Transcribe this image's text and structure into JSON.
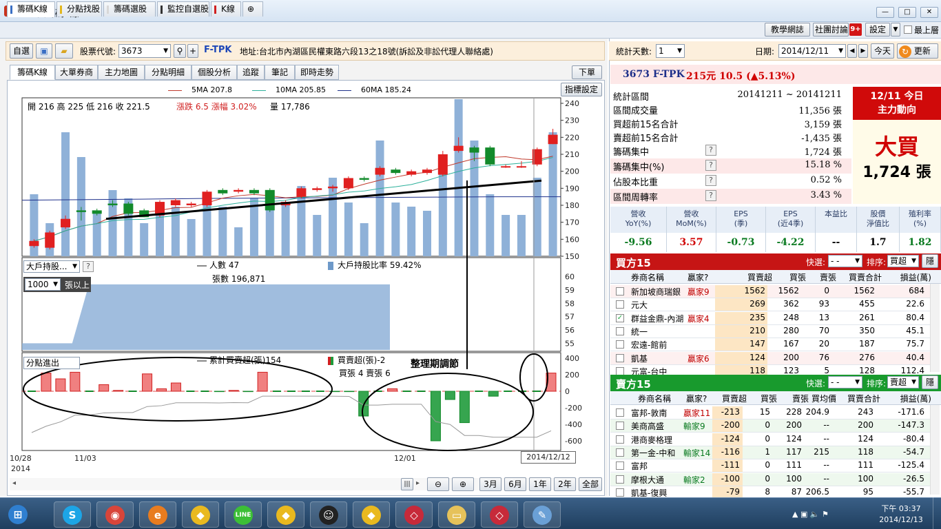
{
  "window": {
    "title": "理財寶籌碼K線"
  },
  "main_tabs": [
    {
      "label": "籌碼K線",
      "color": "#3a6fc4"
    },
    {
      "label": "分點找股",
      "color": "#e2b71d"
    },
    {
      "label": "籌碼選股",
      "color": "#e2e2e2"
    },
    {
      "label": "監控自選股",
      "color": "#333333"
    },
    {
      "label": "K線",
      "color": "#d02020"
    }
  ],
  "top_right": {
    "teach": "教學網誌",
    "forum": "社團討論",
    "forum_badge": "9+",
    "settings": "設定",
    "pin": "最上層"
  },
  "toolbar": {
    "watchlist_label": "自選",
    "code_label": "股票代號:",
    "code_value": "3673",
    "code_suffix": "F-TPK",
    "address": "地址:台北市內湖區民權東路六段13之18號(訴訟及非訟代理人聯絡處)"
  },
  "sub_tabs": [
    "籌碼K線",
    "大單券商",
    "主力地圖",
    "分點明細",
    "個股分析",
    "追蹤",
    "筆記",
    "即時走勢"
  ],
  "sub_tabs_right": {
    "order": "下單",
    "indicator_settings": "指標設定"
  },
  "chart": {
    "ma_legend": [
      {
        "label": "5MA 207.8",
        "color": "#c0392b"
      },
      {
        "label": "10MA 205.85",
        "color": "#2bb09a"
      },
      {
        "label": "60MA 185.24",
        "color": "#1d2f8a"
      }
    ],
    "ohlc_text": "開 216  高 225  低 216  收 221.5",
    "change_text": "漲跌 6.5  漲幅  3.02%",
    "volume_text": "量 17,786",
    "holder_select": "大戶持股...",
    "holder_min": "1000",
    "holder_unit": "張以上",
    "holder_people": "人數 47",
    "holder_shares": "張數 196,871",
    "holder_ratio": "大戶持股比率 59.42%",
    "branch_label": "分點進出",
    "branch_cum": "累計買賣超(張)154",
    "branch_net": "買賣超(張)-2",
    "branch_buysell": "買張 4  賣張 6",
    "annotation": "整理期調節",
    "x_labels": [
      "10/28",
      "2014",
      "11/03",
      "12/01"
    ],
    "date_tag": "2014/12/12",
    "price_ticks": [
      "240",
      "230",
      "220",
      "210",
      "200",
      "190",
      "180",
      "170",
      "160",
      "150"
    ],
    "holder_ticks": [
      "60",
      "59",
      "58",
      "57",
      "56",
      "55"
    ],
    "branch_ticks": [
      "400",
      "200",
      "0",
      "-200",
      "-400",
      "-600"
    ],
    "range_buttons": [
      "3月",
      "6月",
      "1年",
      "2年",
      "全部"
    ]
  },
  "chart_data": {
    "type": "bar",
    "candles": [
      {
        "o": 156,
        "c": 159,
        "h": 160,
        "l": 155
      },
      {
        "o": 155,
        "c": 164,
        "h": 165,
        "l": 154
      },
      {
        "o": 167,
        "c": 172,
        "h": 174,
        "l": 166
      },
      {
        "o": 177,
        "c": 176,
        "h": 179,
        "l": 171
      },
      {
        "o": 177,
        "c": 175,
        "h": 178,
        "l": 174
      },
      {
        "o": 181,
        "c": 180,
        "h": 183,
        "l": 179
      },
      {
        "o": 181,
        "c": 175,
        "h": 182,
        "l": 174
      },
      {
        "o": 177,
        "c": 173,
        "h": 178,
        "l": 173
      },
      {
        "o": 174,
        "c": 182,
        "h": 183,
        "l": 173
      },
      {
        "o": 180,
        "c": 183,
        "h": 184,
        "l": 179
      },
      {
        "o": 180,
        "c": 181,
        "h": 182,
        "l": 179
      },
      {
        "o": 180,
        "c": 188,
        "h": 189,
        "l": 179
      },
      {
        "o": 189,
        "c": 187,
        "h": 190,
        "l": 186
      },
      {
        "o": 188,
        "c": 189,
        "h": 190,
        "l": 187
      },
      {
        "o": 189,
        "c": 187,
        "h": 190,
        "l": 186
      },
      {
        "o": 189,
        "c": 177,
        "h": 190,
        "l": 176
      },
      {
        "o": 180,
        "c": 182,
        "h": 183,
        "l": 179
      },
      {
        "o": 185,
        "c": 190,
        "h": 191,
        "l": 184
      },
      {
        "o": 189,
        "c": 190,
        "h": 191,
        "l": 188
      },
      {
        "o": 190,
        "c": 191,
        "h": 192,
        "l": 188
      },
      {
        "o": 190,
        "c": 196,
        "h": 197,
        "l": 189
      },
      {
        "o": 196,
        "c": 195,
        "h": 197,
        "l": 194
      },
      {
        "o": 198,
        "c": 202,
        "h": 203,
        "l": 197
      },
      {
        "o": 201,
        "c": 199,
        "h": 202,
        "l": 198
      },
      {
        "o": 198,
        "c": 200,
        "h": 201,
        "l": 197
      },
      {
        "o": 199,
        "c": 201,
        "h": 202,
        "l": 198
      },
      {
        "o": 198,
        "c": 210,
        "h": 212,
        "l": 197
      },
      {
        "o": 212,
        "c": 215,
        "h": 220,
        "l": 211
      },
      {
        "o": 214,
        "c": 211,
        "h": 215,
        "l": 206
      },
      {
        "o": 214,
        "c": 204,
        "h": 215,
        "l": 203
      },
      {
        "o": 203,
        "c": 203,
        "h": 204,
        "l": 202
      },
      {
        "o": 203,
        "c": 203,
        "h": 206,
        "l": 202
      },
      {
        "o": 204,
        "c": 213,
        "h": 214,
        "l": 203
      },
      {
        "o": 216,
        "c": 221.5,
        "h": 225,
        "l": 216
      }
    ],
    "volume_rel": [
      0.75,
      0.4,
      1.5,
      1.2,
      0.55,
      0.8,
      0.7,
      0.4,
      0.5,
      0.6,
      0.45,
      0.75,
      0.6,
      0.35,
      0.7,
      0.65,
      0.65,
      0.85,
      0.5,
      0.95,
      0.65,
      0.4,
      1.4,
      0.65,
      0.6,
      0.55,
      1.05,
      1.9,
      1.4,
      0.75,
      0.5,
      0.5,
      0.95,
      1.5
    ],
    "ma60": [
      183,
      183.3,
      183.6,
      184,
      184.2,
      184.4,
      184.6,
      184.8,
      185,
      185
    ],
    "holder_ratio": [
      55,
      55,
      55,
      55,
      59.42,
      59.42,
      59.42,
      59.42,
      59.42,
      59.42,
      59.42,
      59.42,
      59.42,
      59.42,
      59.42,
      59.42,
      59.42,
      59.42,
      59.42,
      59.42,
      59.42,
      59.42,
      59.42
    ],
    "branch_net": [
      0,
      220,
      150,
      230,
      0,
      80,
      10,
      0,
      210,
      30,
      100,
      0,
      0,
      -5,
      10,
      -5,
      230,
      0,
      0,
      0,
      0,
      -5,
      -5,
      -300,
      0,
      30,
      0,
      0,
      -600,
      -100,
      -380,
      0,
      -60,
      0,
      0,
      0,
      220
    ],
    "ylim_price": [
      150,
      240
    ],
    "ylim_holder": [
      54.5,
      60.5
    ],
    "ylim_branch": [
      -600,
      400
    ]
  },
  "right": {
    "days_label": "統計天數:",
    "days_value": "1",
    "date_label": "日期:",
    "date_value": "2014/12/11",
    "today_btn": "今天",
    "refresh_btn": "更新",
    "stock_code": "3673 F-TPK",
    "stock_price": "215元 10.5 (▲5.13%)",
    "stats": [
      {
        "k": "統計區間",
        "v": "20141211 ~ 20141211",
        "q": false,
        "pink": false
      },
      {
        "k": "區間成交量",
        "v": "11,356 張",
        "q": false,
        "pink": false
      },
      {
        "k": "買超前15名合計",
        "v": "3,159 張",
        "q": false,
        "pink": false
      },
      {
        "k": "賣超前15名合計",
        "v": "-1,435 張",
        "q": false,
        "pink": false
      },
      {
        "k": "籌碼集中",
        "v": "1,724 張",
        "q": true,
        "pink": false
      },
      {
        "k": "籌碼集中(%)",
        "v": "15.18 %",
        "q": true,
        "pink": true
      },
      {
        "k": "佔股本比重",
        "v": "0.52 %",
        "q": true,
        "pink": false
      },
      {
        "k": "區間周轉率",
        "v": "3.43 %",
        "q": true,
        "pink": true
      }
    ],
    "today_title1": "12/11 今日",
    "today_title2": "主力動向",
    "today_action": "大買",
    "today_amount": "1,724 張",
    "fin_cols": [
      {
        "h": "營收\nYoY(%)",
        "v": "-9.56",
        "color": "#0a7a20"
      },
      {
        "h": "營收\nMoM(%)",
        "v": "3.57",
        "color": "#d00000"
      },
      {
        "h": "EPS\n(季)",
        "v": "-0.73",
        "color": "#0a7a20"
      },
      {
        "h": "EPS\n(近4季)",
        "v": "-4.22",
        "color": "#0a7a20"
      },
      {
        "h": "本益比",
        "v": "--",
        "color": "#000000"
      },
      {
        "h": "股價\n淨值比",
        "v": "1.7",
        "color": "#000000"
      },
      {
        "h": "殖利率\n(%)",
        "v": "1.82",
        "color": "#0a7a20"
      }
    ],
    "buy_title": "買方15",
    "sell_title": "賣方15",
    "quick_label": "快選:",
    "quick_value": "- -",
    "sort_label": "排序:",
    "buy_sort": "買超",
    "sell_sort": "賣超",
    "hide_btn": "隱",
    "buy_headers": [
      "券商名稱",
      "贏家?",
      "買賣超",
      "買張",
      "賣張",
      "買賣合計",
      "損益(萬)"
    ],
    "buy_rows": [
      {
        "name": "新加坡商瑞銀",
        "tag": "贏家9",
        "net": "1562",
        "buy": "1562",
        "sell": "0",
        "total": "1562",
        "pnl": "684",
        "checked": false
      },
      {
        "name": "元大",
        "tag": "",
        "net": "269",
        "buy": "362",
        "sell": "93",
        "total": "455",
        "pnl": "22.6",
        "checked": false
      },
      {
        "name": "群益金鼎-內湖",
        "tag": "贏家4",
        "net": "235",
        "buy": "248",
        "sell": "13",
        "total": "261",
        "pnl": "80.4",
        "checked": true
      },
      {
        "name": "統一",
        "tag": "",
        "net": "210",
        "buy": "280",
        "sell": "70",
        "total": "350",
        "pnl": "45.1",
        "checked": false
      },
      {
        "name": "宏遠-館前",
        "tag": "",
        "net": "147",
        "buy": "167",
        "sell": "20",
        "total": "187",
        "pnl": "75.7",
        "checked": false
      },
      {
        "name": "凱基",
        "tag": "贏家6",
        "net": "124",
        "buy": "200",
        "sell": "76",
        "total": "276",
        "pnl": "40.4",
        "checked": false
      },
      {
        "name": "元富-台中",
        "tag": "",
        "net": "118",
        "buy": "123",
        "sell": "5",
        "total": "128",
        "pnl": "112.4",
        "checked": false
      }
    ],
    "sell_headers": [
      "券商名稱",
      "贏家?",
      "買賣超",
      "買張",
      "賣張",
      "買均價",
      "買賣合計",
      "損益(萬)"
    ],
    "sell_rows": [
      {
        "name": "富邦-敦南",
        "tag": "贏家11",
        "net": "-213",
        "buy": "15",
        "sell": "228",
        "avg": "204.9",
        "total": "243",
        "pnl": "-171.6",
        "tagcolor": "#c00000"
      },
      {
        "name": "美商高盛",
        "tag": "輸家9",
        "net": "-200",
        "buy": "0",
        "sell": "200",
        "avg": "--",
        "total": "200",
        "pnl": "-147.3",
        "tagcolor": "#0a7a20"
      },
      {
        "name": "港商麥格理",
        "tag": "",
        "net": "-124",
        "buy": "0",
        "sell": "124",
        "avg": "--",
        "total": "124",
        "pnl": "-80.4",
        "tagcolor": "#000000"
      },
      {
        "name": "第一金-中和",
        "tag": "輸家14",
        "net": "-116",
        "buy": "1",
        "sell": "117",
        "avg": "215",
        "total": "118",
        "pnl": "-54.7",
        "tagcolor": "#0a7a20"
      },
      {
        "name": "富邦",
        "tag": "",
        "net": "-111",
        "buy": "0",
        "sell": "111",
        "avg": "--",
        "total": "111",
        "pnl": "-125.4",
        "tagcolor": "#000000"
      },
      {
        "name": "摩根大通",
        "tag": "輸家2",
        "net": "-100",
        "buy": "0",
        "sell": "100",
        "avg": "--",
        "total": "100",
        "pnl": "-26.5",
        "tagcolor": "#0a7a20"
      },
      {
        "name": "凱基-復興",
        "tag": "",
        "net": "-79",
        "buy": "8",
        "sell": "87",
        "avg": "206.5",
        "total": "95",
        "pnl": "-55.7",
        "tagcolor": "#000000"
      }
    ]
  },
  "taskbar": {
    "icons": [
      "start-orb",
      "skype-icon",
      "chrome-icon",
      "ie-icon",
      "app-icon",
      "line-icon",
      "app-icon",
      "qq-icon",
      "app-icon",
      "gem-icon",
      "folder-icon",
      "gem-icon",
      "paint-icon"
    ],
    "time": "下午 03:37",
    "date": "2014/12/13"
  }
}
